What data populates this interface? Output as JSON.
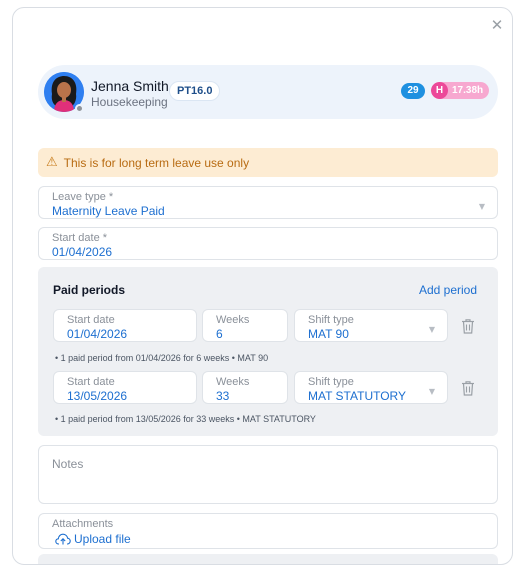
{
  "profile": {
    "name": "Jenna Smith",
    "department": "Housekeeping",
    "role_badge": "PT16.0",
    "count_badge": "29",
    "hours_prefix": "H",
    "hours_value": "17.38h",
    "avatar_icon": "user-avatar-icon"
  },
  "warning": {
    "icon": "warning-triangle-icon",
    "text": "This is for long term leave use only"
  },
  "leave_type": {
    "label": "Leave type *",
    "value": "Maternity Leave Paid"
  },
  "start_date": {
    "label": "Start date *",
    "value": "01/04/2026"
  },
  "paid_periods": {
    "title": "Paid periods",
    "add_label": "Add period",
    "rows": [
      {
        "start_label": "Start date",
        "start_value": "01/04/2026",
        "weeks_label": "Weeks",
        "weeks_value": "6",
        "shift_label": "Shift type",
        "shift_value": "MAT 90",
        "note": "• 1 paid period from 01/04/2026 for 6 weeks • MAT 90"
      },
      {
        "start_label": "Start date",
        "start_value": "13/05/2026",
        "weeks_label": "Weeks",
        "weeks_value": "33",
        "shift_label": "Shift type",
        "shift_value": "MAT STATUTORY",
        "note": "• 1 paid period from 13/05/2026 for 33 weeks • MAT STATUTORY"
      }
    ]
  },
  "notes": {
    "placeholder": "Notes"
  },
  "attachments": {
    "label": "Attachments",
    "upload_label": "Upload file"
  },
  "colors": {
    "accent": "#1d6fd0",
    "warning_bg": "#fdecd3",
    "warning_text": "#b86b12",
    "count_badge": "#1f90e0",
    "hours_badge": "#ec4899"
  }
}
